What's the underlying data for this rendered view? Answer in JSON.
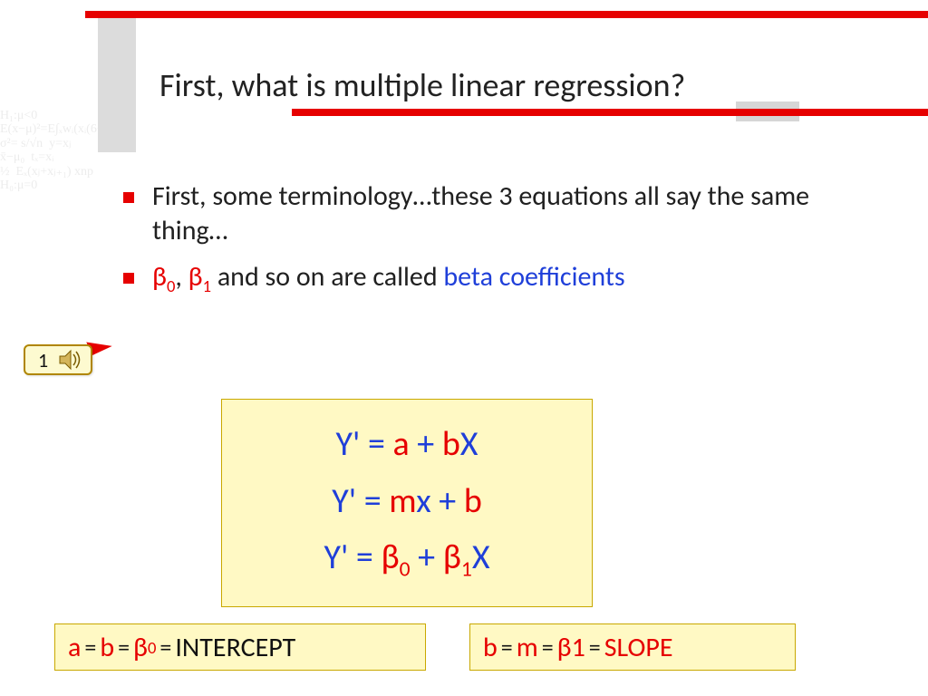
{
  "title": "First, what is multiple linear regression?",
  "bullets": {
    "b1": "First, some terminology…these 3 equations all say the same thing…",
    "b2_pre": "β",
    "b2_sub0": "0",
    "b2_mid": ", ",
    "b2_sub1": "1",
    "b2_text": " and so on are called ",
    "b2_blue": "beta coefficients"
  },
  "callout": {
    "label": "1"
  },
  "equations": {
    "eq1": {
      "y": "Y' = ",
      "a": "a",
      "plus": " + ",
      "b": "b",
      "x": "X"
    },
    "eq2": {
      "y": "Y' = ",
      "m": "m",
      "x": "x",
      "plus": " + ",
      "b": "b"
    },
    "eq3": {
      "y": "Y' = ",
      "beta": "β",
      "s0": "0",
      "plus": " + ",
      "s1": "1",
      "x": "X"
    }
  },
  "intercept": {
    "a": "a",
    "eq": " = ",
    "b": "b",
    "beta": "β",
    "s0": "0",
    "label": "INTERCEPT"
  },
  "slope": {
    "b": "b",
    "eq": " = ",
    "m": "m",
    "beta": "β",
    "s1": "1",
    "label": "SLOPE"
  },
  "mathbg": "H₁:μ<0\nE(x−μ)²=E∫ₓwᵢ(xᵢ(6−1)=ĥ\nσ²= s/√n  y=xⱼ\nx̄−μ₀  tₓ=xᵢ\n½  Eₓ(xⱼ+xⱼ₊₁) xnp\nH₀:μ=0"
}
